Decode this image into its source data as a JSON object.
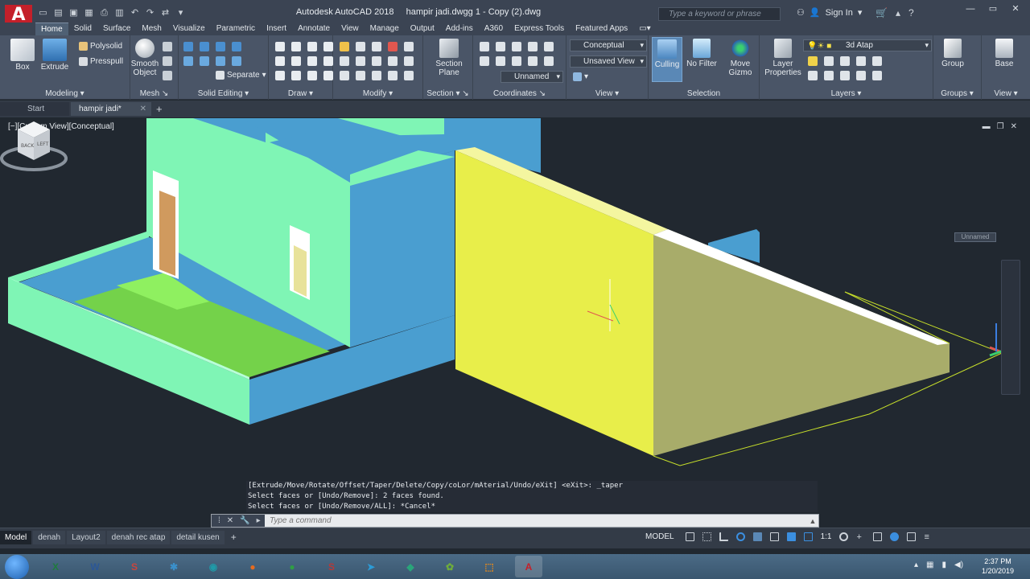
{
  "app": {
    "name": "Autodesk AutoCAD 2018",
    "document": "hampir jadi.dwgg 1 - Copy (2).dwg",
    "logo_letter": "A"
  },
  "search": {
    "placeholder": "Type a keyword or phrase"
  },
  "account": {
    "signin": "Sign In"
  },
  "ribbon_tabs": [
    "Home",
    "Solid",
    "Surface",
    "Mesh",
    "Visualize",
    "Parametric",
    "Insert",
    "Annotate",
    "View",
    "Manage",
    "Output",
    "Add-ins",
    "A360",
    "Express Tools",
    "Featured Apps"
  ],
  "ribbon": {
    "modeling": {
      "label": "Modeling",
      "box": "Box",
      "extrude": "Extrude",
      "polysolid": "Polysolid",
      "presspull": "Presspull"
    },
    "mesh": {
      "label": "Mesh",
      "smooth_object": "Smooth Object"
    },
    "solid_editing": {
      "label": "Solid Editing",
      "separate": "Separate"
    },
    "draw": {
      "label": "Draw"
    },
    "modify": {
      "label": "Modify"
    },
    "section": {
      "label": "Section",
      "section_plane": "Section Plane"
    },
    "coordinates": {
      "label": "Coordinates",
      "ucs_name": "Unnamed"
    },
    "view": {
      "label": "View",
      "visual_style": "Conceptual",
      "saved_view": "Unsaved View"
    },
    "selection": {
      "label": "Selection",
      "culling": "Culling",
      "no_filter": "No Filter",
      "move_gizmo": "Move Gizmo"
    },
    "layers": {
      "label": "Layers",
      "layer_properties": "Layer Properties",
      "current_layer": "3d Atap"
    },
    "groups": {
      "label": "Groups",
      "group": "Group"
    },
    "view2": {
      "label": "View",
      "base": "Base"
    }
  },
  "file_tabs": {
    "start": "Start",
    "current": "hampir jadi*"
  },
  "viewport": {
    "label": "[−][Custom View][Conceptual]",
    "viewcube_back": "BACK",
    "viewcube_left": "LEFT",
    "wcs": "Unnamed"
  },
  "command": {
    "history": [
      "[Extrude/Move/Rotate/Offset/Taper/Delete/Copy/coLor/mAterial/Undo/eXit] <eXit>: _taper",
      "Select faces or [Undo/Remove]: 2 faces found.",
      "Select faces or [Undo/Remove/ALL]: *Cancel*"
    ],
    "placeholder": "Type a command"
  },
  "layout_tabs": [
    "Model",
    "denah",
    "Layout2",
    "denah rec atap",
    "detail kusen"
  ],
  "status": {
    "model": "MODEL",
    "scale": "1:1"
  },
  "taskbar": {
    "apps": [
      {
        "name": "excel",
        "glyph": "X",
        "color": "#1f7a3e"
      },
      {
        "name": "word",
        "glyph": "W",
        "color": "#2b5797"
      },
      {
        "name": "sketchup",
        "glyph": "S",
        "color": "#c9463d"
      },
      {
        "name": "tool",
        "glyph": "✱",
        "color": "#3a8fc9"
      },
      {
        "name": "camera",
        "glyph": "◉",
        "color": "#1f9aa8"
      },
      {
        "name": "firefox",
        "glyph": "●",
        "color": "#e66b1f"
      },
      {
        "name": "chrome",
        "glyph": "●",
        "color": "#2f9e44"
      },
      {
        "name": "sketchup2",
        "glyph": "S",
        "color": "#b53a3a"
      },
      {
        "name": "telegram",
        "glyph": "➤",
        "color": "#2c9bd6"
      },
      {
        "name": "gem",
        "glyph": "◆",
        "color": "#2aa57a"
      },
      {
        "name": "leaf",
        "glyph": "✿",
        "color": "#6fae3a"
      },
      {
        "name": "pdf",
        "glyph": "⬚",
        "color": "#e0871e"
      },
      {
        "name": "autocad",
        "glyph": "A",
        "color": "#c4202a"
      }
    ],
    "time": "2:37 PM",
    "date": "1/20/2019"
  },
  "colors": {
    "wall_green": "#7ff5b5",
    "wall_blue": "#4a9ed0",
    "wall_yellow": "#e8ee4a",
    "wall_olive": "#a8ac6a",
    "floor_green": "#74d24a",
    "door_wood": "#d09a5e"
  }
}
